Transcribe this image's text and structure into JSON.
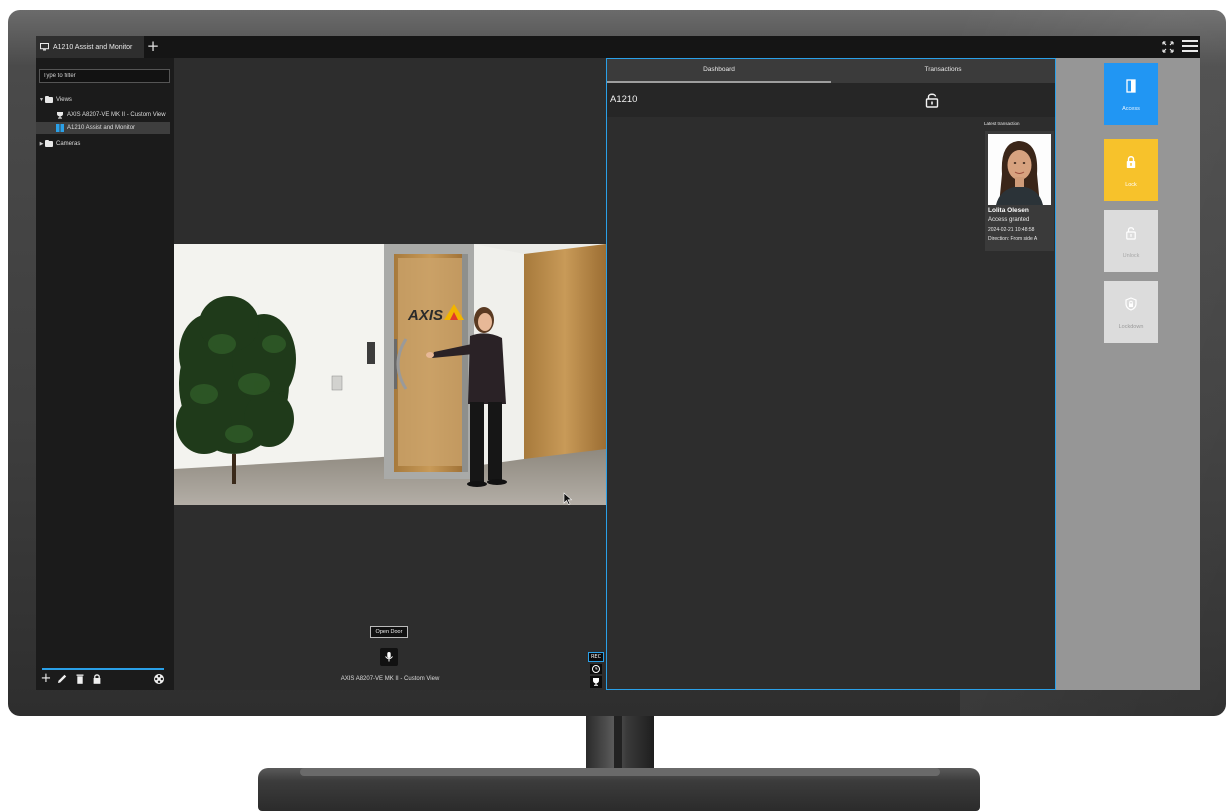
{
  "tabbar": {
    "active_tab": "A1210 Assist and Monitor",
    "add_tab_label": "+"
  },
  "sidebar": {
    "filter_placeholder": "Type to filter",
    "tree": {
      "views_label": "Views",
      "items": [
        "AXIS A8207-VE MK II - Custom View",
        "A1210 Assist and Monitor"
      ],
      "cameras_label": "Cameras"
    }
  },
  "camera": {
    "open_door_label": "Open Door",
    "caption": "AXIS A8207-VE MK II - Custom View",
    "rec_label": "REC",
    "video_brand": "AXIS"
  },
  "door_panel": {
    "tabs": [
      "Dashboard",
      "Transactions"
    ],
    "door_name": "A1210",
    "latest_label": "Latest transaction",
    "transaction": {
      "name": "Lolita Olesen",
      "status": "Access granted",
      "timestamp": "2024-02-21 10:48:58",
      "direction": "Direction: From side A"
    }
  },
  "actions": [
    "Access",
    "Lock",
    "Unlock",
    "Lockdown"
  ],
  "colors": {
    "accent": "#2aa0e8",
    "access": "#2196f3",
    "lock": "#f7c22b",
    "inactive": "#dcdcdc"
  }
}
